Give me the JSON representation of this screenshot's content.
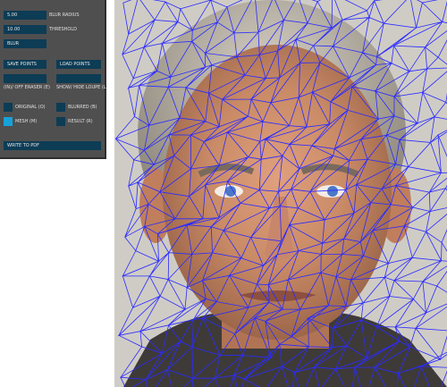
{
  "panel": {
    "blur_radius": {
      "value": "5.00",
      "label": "BLUR RADIUS"
    },
    "threshold": {
      "value": "10.00",
      "label": "THRESHOLD"
    },
    "blur_button": "BLUR",
    "save_points": "SAVE POINTS",
    "load_points": "LOAD POINTS",
    "eraser_label": "(IN)/ OFF ERASER (E)",
    "loupe_label": "SHOW/ HIDE LOUPE (L)",
    "toggles": [
      {
        "label": "ORIGINAL (O)",
        "on": false
      },
      {
        "label": "BLURRED (B)",
        "on": false
      },
      {
        "label": "MESH (M)",
        "on": true
      },
      {
        "label": "RESULT (R)",
        "on": false
      }
    ],
    "write_pdf": "WRITE TO PDF"
  },
  "colors": {
    "panel_bg": "#4f4f4f",
    "control_bg": "#0d3c55",
    "toggle_on": "#16a2d8",
    "mesh": "#2b2bff"
  }
}
